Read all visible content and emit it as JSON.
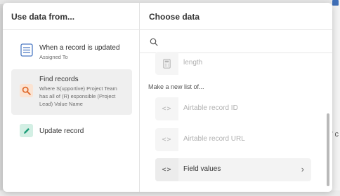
{
  "background": {
    "side_text": "f c"
  },
  "left_pane": {
    "title": "Use data from...",
    "steps": [
      {
        "title": "When a record is updated",
        "subtitle": "Assigned To",
        "icon": "table-grid-icon",
        "icon_color": "#4a78c2"
      },
      {
        "title": "Find records",
        "subtitle": "Where S(upportive) Project Team has all of (R) esponsible (Project Lead) Value Name",
        "icon": "magnifier-icon",
        "icon_color": "#e06a2c"
      },
      {
        "title": "Update record",
        "subtitle": "",
        "icon": "pencil-icon",
        "icon_color": "#1f9e7a"
      }
    ]
  },
  "right_pane": {
    "title": "Choose data",
    "search": {
      "placeholder": "",
      "value": ""
    },
    "fields_top": [
      {
        "label": "length",
        "icon": "calculator-icon",
        "enabled": false
      }
    ],
    "section_label": "Make a new list of...",
    "fields": [
      {
        "label": "Airtable record ID",
        "icon": "code-icon",
        "enabled": false
      },
      {
        "label": "Airtable record URL",
        "icon": "code-icon",
        "enabled": false
      },
      {
        "label": "Field values",
        "icon": "code-icon",
        "enabled": true,
        "has_submenu": true
      }
    ]
  },
  "colors": {
    "selected_row": "#efefef",
    "disabled_text": "#b0b0b0"
  }
}
